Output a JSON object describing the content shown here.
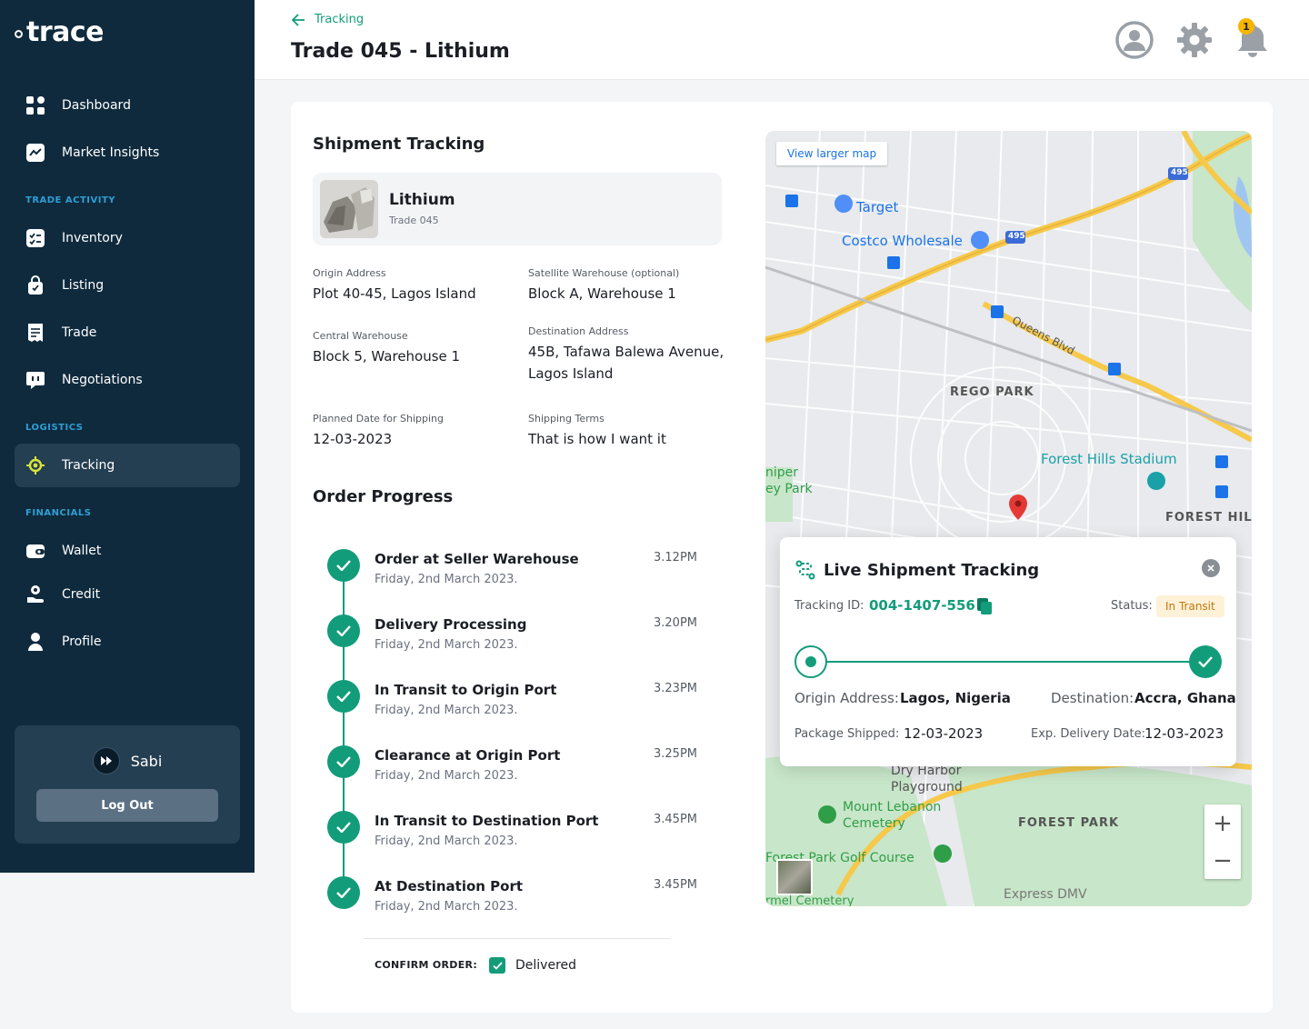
{
  "brand": {
    "name": "trace"
  },
  "sidebar": {
    "items": [
      {
        "id": "dashboard",
        "label": "Dashboard",
        "icon": "grid-icon"
      },
      {
        "id": "market-insights",
        "label": "Market Insights",
        "icon": "chart-icon"
      }
    ],
    "sections": [
      {
        "label": "TRADE ACTIVITY",
        "items": [
          {
            "id": "inventory",
            "label": "Inventory",
            "icon": "checklist-icon"
          },
          {
            "id": "listing",
            "label": "Listing",
            "icon": "bag-icon"
          },
          {
            "id": "trade",
            "label": "Trade",
            "icon": "receipt-icon"
          },
          {
            "id": "negotiations",
            "label": "Negotiations",
            "icon": "chat-icon"
          }
        ]
      },
      {
        "label": "LOGISTICS",
        "items": [
          {
            "id": "tracking",
            "label": "Tracking",
            "icon": "target-icon",
            "active": true
          }
        ]
      },
      {
        "label": "FINANCIALS",
        "items": [
          {
            "id": "wallet",
            "label": "Wallet",
            "icon": "wallet-icon"
          },
          {
            "id": "credit",
            "label": "Credit",
            "icon": "hand-coin-icon"
          },
          {
            "id": "profile",
            "label": "Profile",
            "icon": "person-icon"
          }
        ]
      }
    ],
    "user": {
      "name": "Sabi",
      "logout_label": "Log Out"
    }
  },
  "header": {
    "back_label": "Tracking",
    "title": "Trade 045 - Lithium",
    "notification_count": "1"
  },
  "shipment": {
    "title": "Shipment Tracking",
    "product_name": "Lithium",
    "product_sub": "Trade 045",
    "fields": {
      "origin_label": "Origin Address",
      "origin_value": "Plot 40-45, Lagos Island",
      "satellite_label": "Satellite Warehouse (optional)",
      "satellite_value": "Block A, Warehouse 1",
      "central_label": "Central Warehouse",
      "central_value": "Block 5, Warehouse 1",
      "destination_label": "Destination Address",
      "destination_value": "45B, Tafawa Balewa Avenue, Lagos Island",
      "planned_label": "Planned Date for Shipping",
      "planned_value": "12-03-2023",
      "terms_label": "Shipping Terms",
      "terms_value": "That is how I want it"
    }
  },
  "progress": {
    "title": "Order Progress",
    "steps": [
      {
        "title": "Order at Seller Warehouse",
        "date": "Friday, 2nd March 2023.",
        "time": "3.12PM"
      },
      {
        "title": "Delivery Processing",
        "date": "Friday, 2nd March 2023.",
        "time": "3.20PM"
      },
      {
        "title": "In Transit to Origin Port",
        "date": "Friday, 2nd March 2023.",
        "time": "3.23PM"
      },
      {
        "title": "Clearance at Origin Port",
        "date": "Friday, 2nd March 2023.",
        "time": "3.25PM"
      },
      {
        "title": "In Transit to Destination Port",
        "date": "Friday, 2nd March 2023.",
        "time": "3.45PM"
      },
      {
        "title": "At Destination Port",
        "date": "Friday, 2nd March 2023.",
        "time": "3.45PM"
      }
    ],
    "confirm_label": "CONFIRM ORDER:",
    "confirm_value": "Delivered"
  },
  "map": {
    "view_larger": "View larger map",
    "labels": {
      "target": "Target",
      "costco": "Costco Wholesale",
      "rego_park": "REGO PARK",
      "forest_hills_stadium": "Forest Hills Stadium",
      "forest_hills": "FOREST HIL",
      "juniper": "niper",
      "juniper2": "ey Park",
      "queens_blvd": "Queens Blvd",
      "dry_harbor": "Dry Harbor",
      "playground": "Playground",
      "mount_lebanon": "Mount Lebanon",
      "cemetery": "Cemetery",
      "forest_park": "FOREST PARK",
      "golf_course": "Forest Park Golf Course",
      "express_dmv": "Express DMV",
      "rmel": "rmel Cemetery",
      "hwy_495a": "495",
      "hwy_495b": "495"
    },
    "zoom_in": "+",
    "zoom_out": "−"
  },
  "live": {
    "title": "Live Shipment Tracking",
    "tracking_id_label": "Tracking ID:",
    "tracking_id": "004-1407-556",
    "status_label": "Status:",
    "status": "In Transit",
    "origin_label": "Origin Address:",
    "origin_value": "Lagos, Nigeria",
    "destination_label": "Destination:",
    "destination_value": "Accra, Ghana",
    "shipped_label": "Package Shipped:",
    "shipped_value": "12-03-2023",
    "delivery_label": "Exp. Delivery Date:",
    "delivery_value": "12-03-2023"
  },
  "colors": {
    "sidebar": "#0f2a3d",
    "accent": "#129c7a",
    "sidebar_active": "#253f52",
    "section": "#2e9fd4"
  }
}
